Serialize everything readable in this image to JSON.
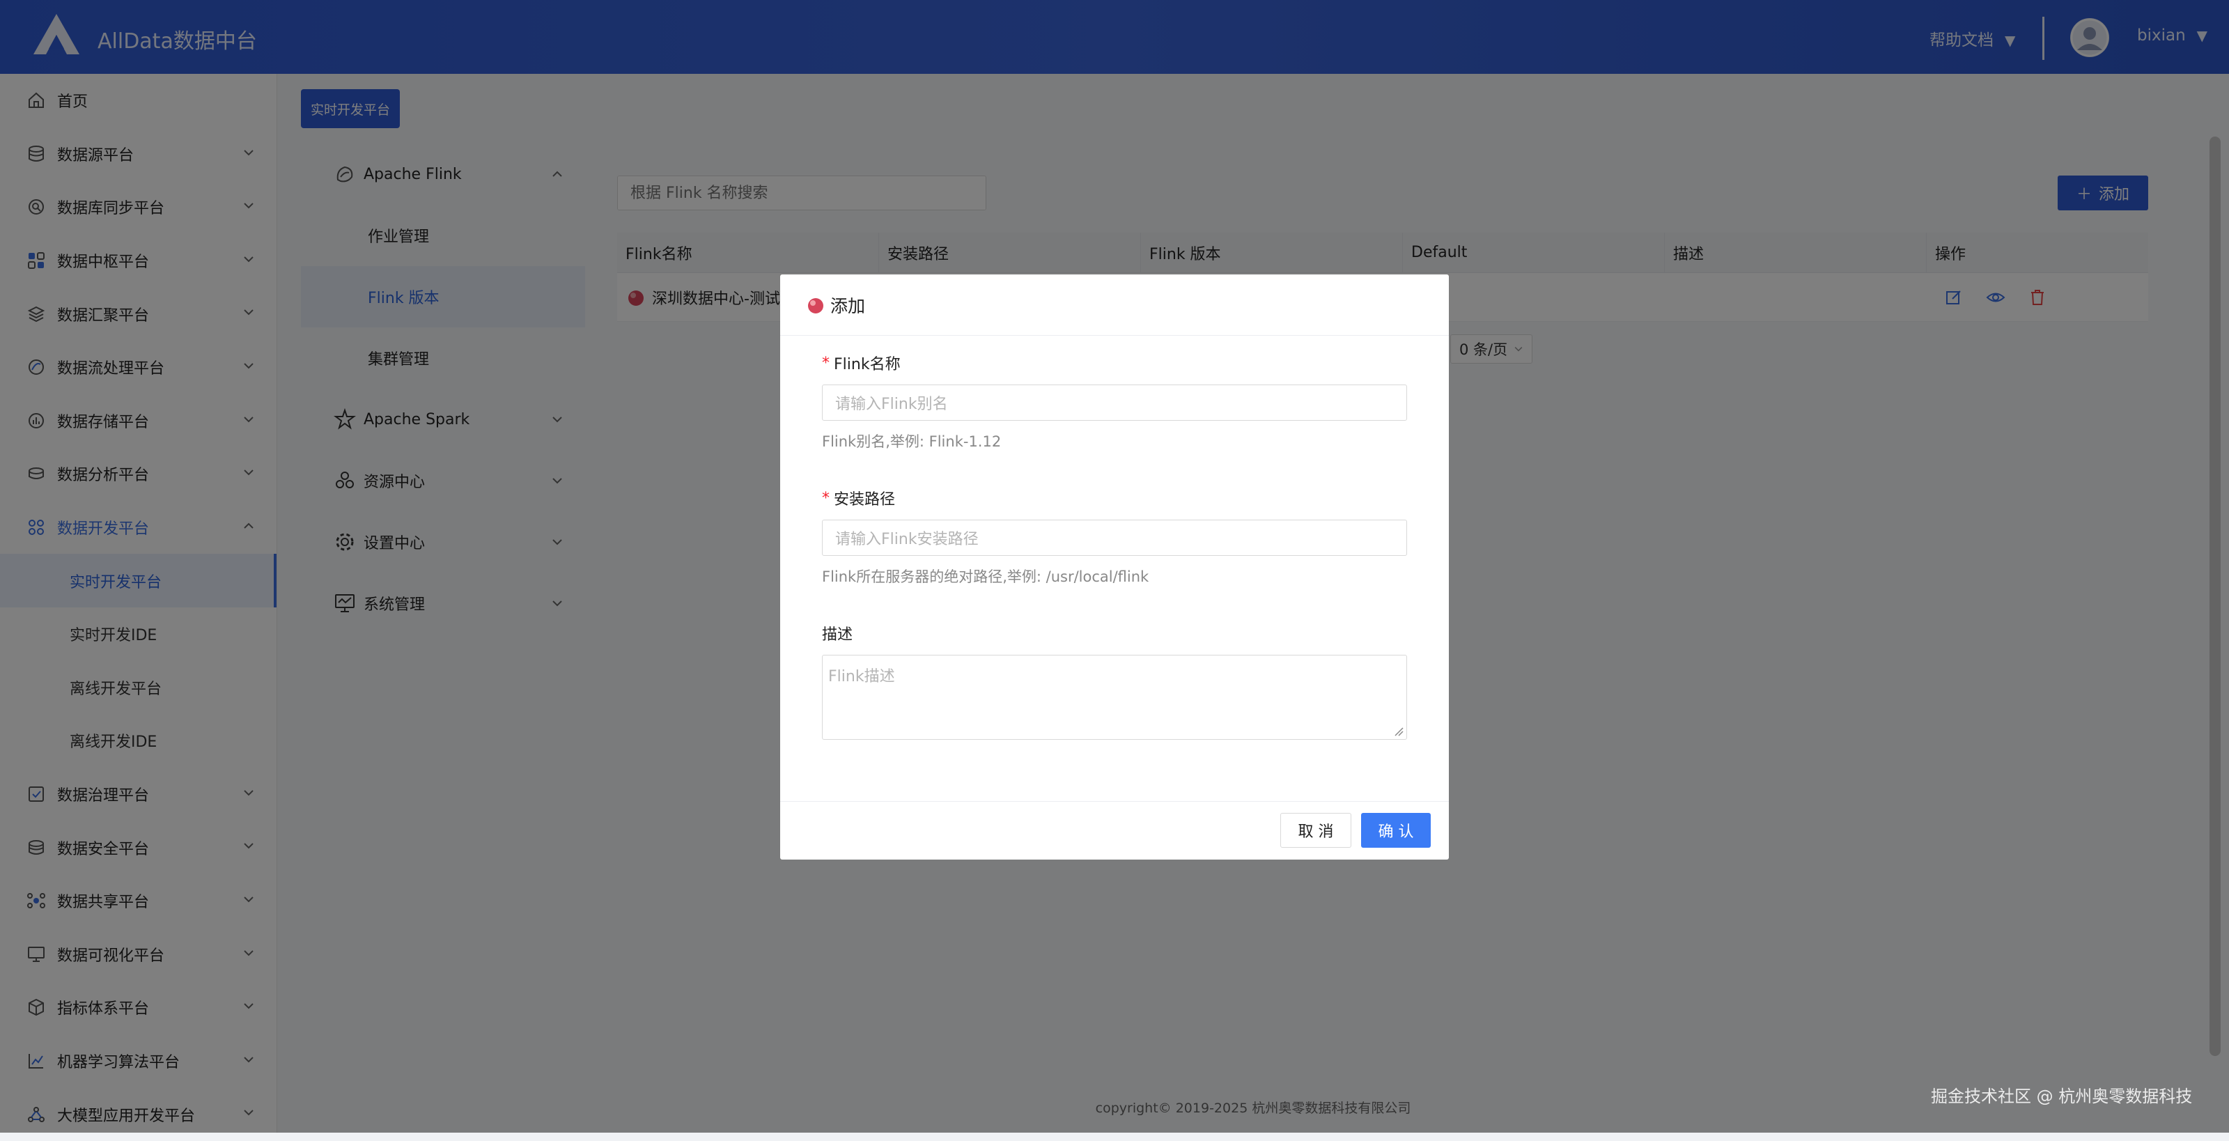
{
  "header": {
    "app_title": "AllData数据中台",
    "help_docs": "帮助文档",
    "username": "bixian",
    "caret": "▼"
  },
  "sidebar": {
    "items": [
      {
        "label": "首页",
        "icon": "home-icon"
      },
      {
        "label": "数据源平台",
        "icon": "database-icon"
      },
      {
        "label": "数据库同步平台",
        "icon": "sync-icon"
      },
      {
        "label": "数据中枢平台",
        "icon": "hub-icon"
      },
      {
        "label": "数据汇聚平台",
        "icon": "layers-icon"
      },
      {
        "label": "数据流处理平台",
        "icon": "stream-icon"
      },
      {
        "label": "数据存储平台",
        "icon": "storage-icon"
      },
      {
        "label": "数据分析平台",
        "icon": "analysis-icon"
      },
      {
        "label": "数据开发平台",
        "icon": "develop-icon"
      }
    ],
    "sub_items": [
      "实时开发平台",
      "实时开发IDE",
      "离线开发平台",
      "离线开发IDE"
    ],
    "items_after": [
      {
        "label": "数据治理平台",
        "icon": "governance-icon"
      },
      {
        "label": "数据安全平台",
        "icon": "security-icon"
      },
      {
        "label": "数据共享平台",
        "icon": "share-icon"
      },
      {
        "label": "数据可视化平台",
        "icon": "visual-icon"
      },
      {
        "label": "指标体系平台",
        "icon": "metrics-icon"
      },
      {
        "label": "机器学习算法平台",
        "icon": "ml-icon"
      },
      {
        "label": "大模型应用开发平台",
        "icon": "llm-icon"
      }
    ]
  },
  "content": {
    "crumb": "实时开发平台",
    "subnav": {
      "flink": "Apache Flink",
      "flink_children": [
        "作业管理",
        "Flink 版本",
        "集群管理"
      ],
      "spark": "Apache Spark",
      "resource": "资源中心",
      "settings": "设置中心",
      "system": "系统管理"
    },
    "search_placeholder": "根据 Flink 名称搜索",
    "add_button": "添加",
    "table": {
      "headers": [
        "Flink名称",
        "安装路径",
        "Flink 版本",
        "Default",
        "描述",
        "操作"
      ],
      "row_name": "深圳数据中心-测试"
    },
    "pager": "0 条/页",
    "footer": "copyright© 2019-2025 杭州奥零数据科技有限公司"
  },
  "modal": {
    "title": "添加",
    "name_label": "Flink名称",
    "name_placeholder": "请输入Flink别名",
    "name_help": "Flink别名,举例: Flink-1.12",
    "path_label": "安装路径",
    "path_placeholder": "请输入Flink安装路径",
    "path_help": "Flink所在服务器的绝对路径,举例: /usr/local/flink",
    "desc_label": "描述",
    "desc_placeholder": "Flink描述",
    "required_mark": "*",
    "cancel": "取 消",
    "confirm": "确 认"
  },
  "watermark": "掘金技术社区 @ 杭州奥零数据科技",
  "colors": {
    "header_bg": "#2f5bd2",
    "primary": "#3b7bf5",
    "active_text": "#2d62d8"
  }
}
